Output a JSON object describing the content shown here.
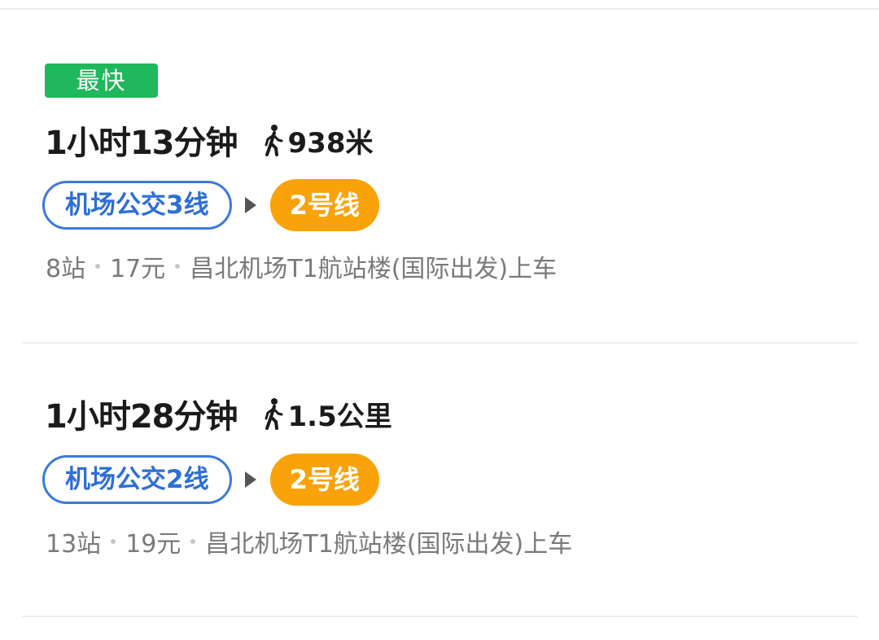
{
  "routes": [
    {
      "badge": "最快",
      "duration": "1小时13分钟",
      "walk_distance": "938米",
      "bus_line": "机场公交3线",
      "metro_line": "2号线",
      "stops": "8站",
      "fare": "17元",
      "boarding": "昌北机场T1航站楼(国际出发)上车"
    },
    {
      "duration": "1小时28分钟",
      "walk_distance": "1.5公里",
      "bus_line": "机场公交2线",
      "metro_line": "2号线",
      "stops": "13站",
      "fare": "19元",
      "boarding": "昌北机场T1航站楼(国际出发)上车"
    }
  ],
  "colors": {
    "badge_green": "#1fb85c",
    "bus_blue": "#2e6fd6",
    "metro_orange": "#f9a20a",
    "info_gray": "#7a7a7a"
  },
  "icons": {
    "walk": "walking-person-icon",
    "transfer": "play-arrow-icon"
  }
}
